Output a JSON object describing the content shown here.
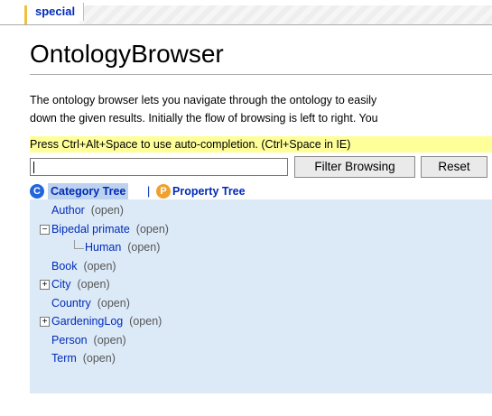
{
  "tabs": {
    "active": "special"
  },
  "page_title": "OntologyBrowser",
  "intro_lines": [
    "The ontology browser lets you navigate through the ontology to easily",
    "down the given results. Initially the flow of browsing is left to right. You"
  ],
  "hint": "Press Ctrl+Alt+Space to use auto-completion. (Ctrl+Space in IE)",
  "filter": {
    "value": "",
    "placeholder": "",
    "filter_button": "Filter Browsing",
    "reset_button": "Reset"
  },
  "tree_tabs": {
    "category": {
      "label": "Category Tree",
      "icon": "category-icon",
      "icon_char": "C"
    },
    "separator": "|",
    "property": {
      "label": "Property Tree",
      "icon": "property-icon",
      "icon_char": "P"
    }
  },
  "tree": {
    "open_label": "(open)",
    "items": [
      {
        "name": "Author",
        "expander": "none"
      },
      {
        "name": "Bipedal primate",
        "expander": "minus"
      },
      {
        "name": "Human",
        "expander": "child"
      },
      {
        "name": "Book",
        "expander": "none"
      },
      {
        "name": "City",
        "expander": "plus"
      },
      {
        "name": "Country",
        "expander": "none"
      },
      {
        "name": "GardeningLog",
        "expander": "plus"
      },
      {
        "name": "Person",
        "expander": "none"
      },
      {
        "name": "Term",
        "expander": "none"
      }
    ]
  }
}
